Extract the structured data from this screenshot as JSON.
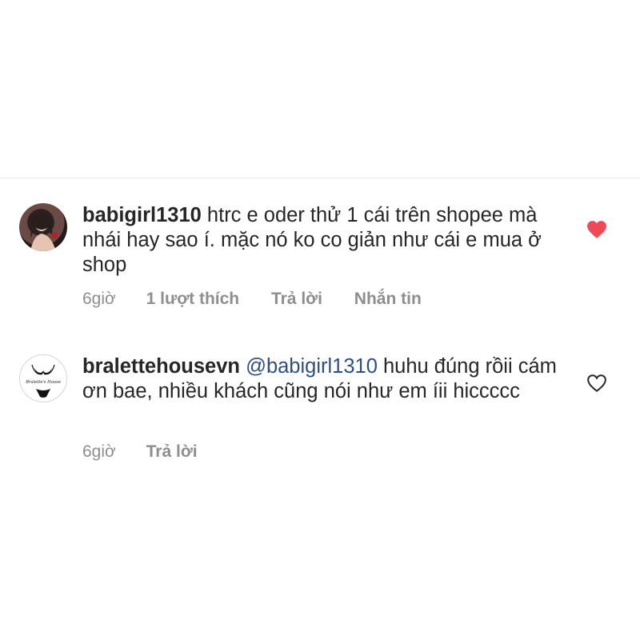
{
  "comments": [
    {
      "username": "babigirl1310",
      "mention": "",
      "text": "htrc e oder thử 1 cái trên shopee mà nhái hay sao í. mặc nó ko co giản như cái e mua ở shop",
      "time": "6giờ",
      "likes": "1 lượt thích",
      "reply": "Trả lời",
      "message": "Nhắn tin",
      "liked": true,
      "like_icon": "heart-filled-icon",
      "like_color": "#ed4956"
    },
    {
      "username": "bralettehousevn",
      "mention": "@babigirl1310",
      "text": "huhu đúng rồii cám ơn bae, nhiều khách cũng nói như em íii hiccccc",
      "time": "6giờ",
      "reply": "Trả lời",
      "liked": false,
      "like_icon": "heart-outline-icon",
      "logo_text": "Bralette's House"
    }
  ],
  "colors": {
    "text": "#262626",
    "meta": "#8e8e8e",
    "mention": "#2f4f80",
    "divider": "#e6e6e6"
  }
}
